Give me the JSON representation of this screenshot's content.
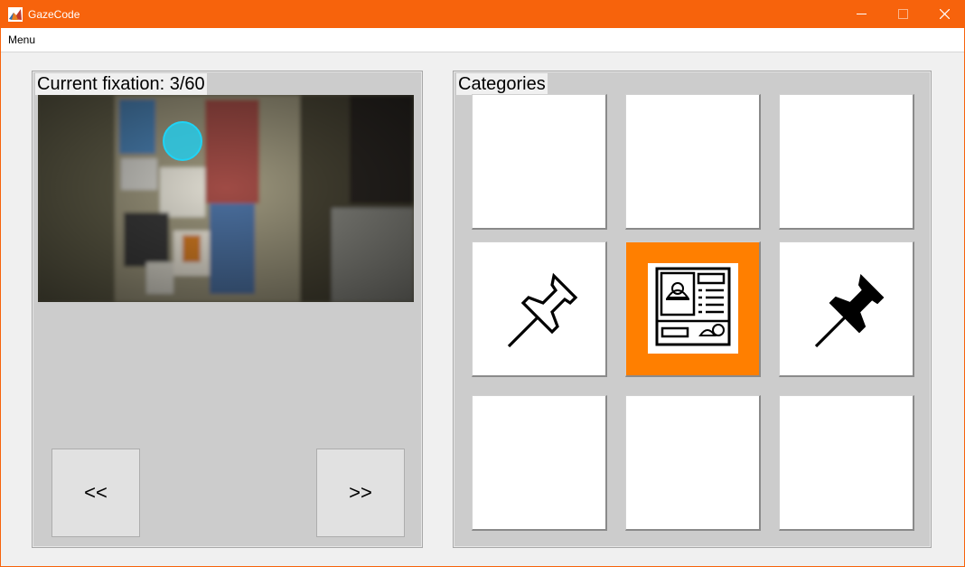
{
  "window": {
    "title": "GazeCode",
    "app_icon": "matlab-icon"
  },
  "menubar": {
    "items": [
      "Menu"
    ]
  },
  "left_panel": {
    "title": "Current fixation: 3/60",
    "fixation_marker_color": "#27c9e6",
    "prev_label": "<<",
    "next_label": ">>"
  },
  "right_panel": {
    "title": "Categories",
    "tiles": [
      {
        "icon": "none",
        "selected": false
      },
      {
        "icon": "none",
        "selected": false
      },
      {
        "icon": "none",
        "selected": false
      },
      {
        "icon": "pushpin-outline-icon",
        "selected": false
      },
      {
        "icon": "menu-board-icon",
        "selected": true
      },
      {
        "icon": "pushpin-filled-icon",
        "selected": false
      },
      {
        "icon": "none",
        "selected": false
      },
      {
        "icon": "none",
        "selected": false
      },
      {
        "icon": "none",
        "selected": false
      }
    ],
    "selected_color": "#ff7f00"
  },
  "colors": {
    "titlebar": "#f7630c",
    "panel": "#cccccc",
    "background": "#f0f0f0"
  }
}
